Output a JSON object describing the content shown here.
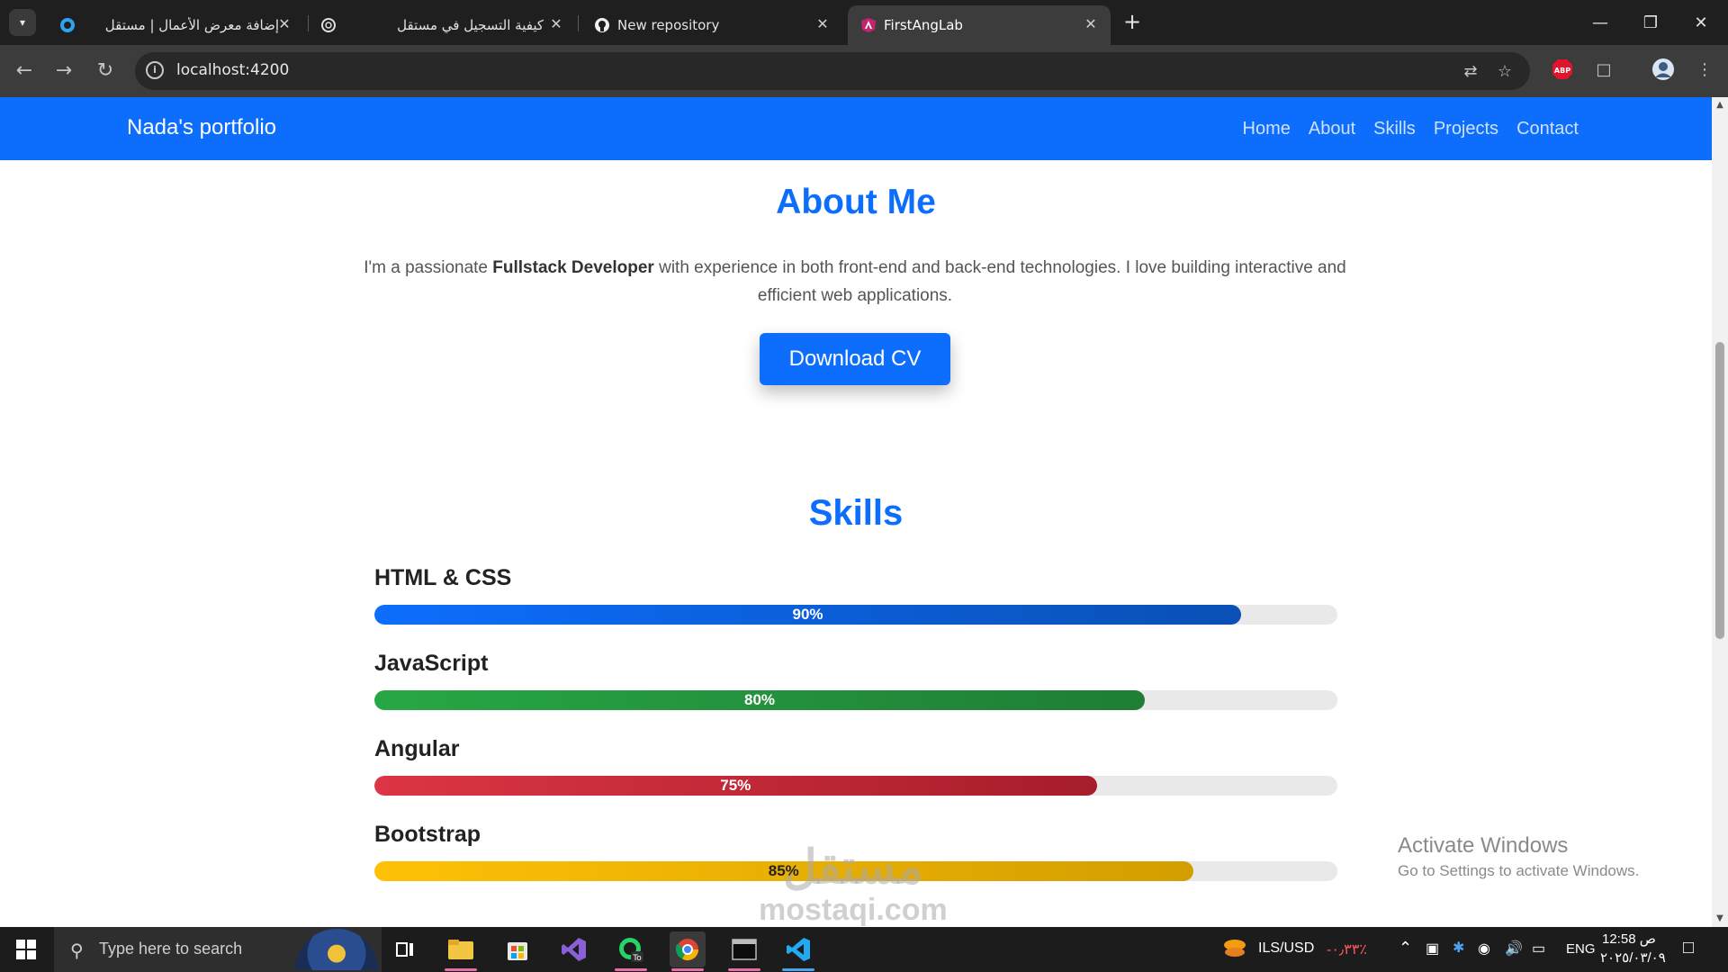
{
  "browser": {
    "tabs": [
      {
        "title": "إضافة معرض الأعمال | مستقل",
        "active": false
      },
      {
        "title": "كيفية التسجيل في مستقل",
        "active": false
      },
      {
        "title": "New repository",
        "active": false
      },
      {
        "title": "FirstAngLab",
        "active": true
      }
    ],
    "url": "localhost:4200"
  },
  "page": {
    "brand": "Nada's portfolio",
    "nav": [
      "Home",
      "About",
      "Skills",
      "Projects",
      "Contact"
    ],
    "about": {
      "title": "About Me",
      "text_before": "I'm a passionate ",
      "text_bold": "Fullstack Developer",
      "text_after": " with experience in both front-end and back-end technologies. I love building interactive and efficient web applications.",
      "button": "Download CV"
    },
    "skills": {
      "title": "Skills",
      "items": [
        {
          "name": "HTML & CSS",
          "percent": 90,
          "label": "90%",
          "color": "#0d6efd"
        },
        {
          "name": "JavaScript",
          "percent": 80,
          "label": "80%",
          "color": "#28a745"
        },
        {
          "name": "Angular",
          "percent": 75,
          "label": "75%",
          "color": "#dc3545"
        },
        {
          "name": "Bootstrap",
          "percent": 85,
          "label": "85%",
          "color": "#ffc107"
        }
      ]
    }
  },
  "windows_notice": {
    "line1": "Activate Windows",
    "line2": "Go to Settings to activate Windows."
  },
  "watermark": {
    "line1": "مستقل",
    "line2": "mostaqi.com"
  },
  "taskbar": {
    "search_placeholder": "Type here to search",
    "currency": "ILS/USD",
    "currency_change": "-٠٫٣٣٪",
    "language": "ENG",
    "time": "12:58 ص",
    "date": "٢٠٢٥/٠٣/٠٩"
  }
}
